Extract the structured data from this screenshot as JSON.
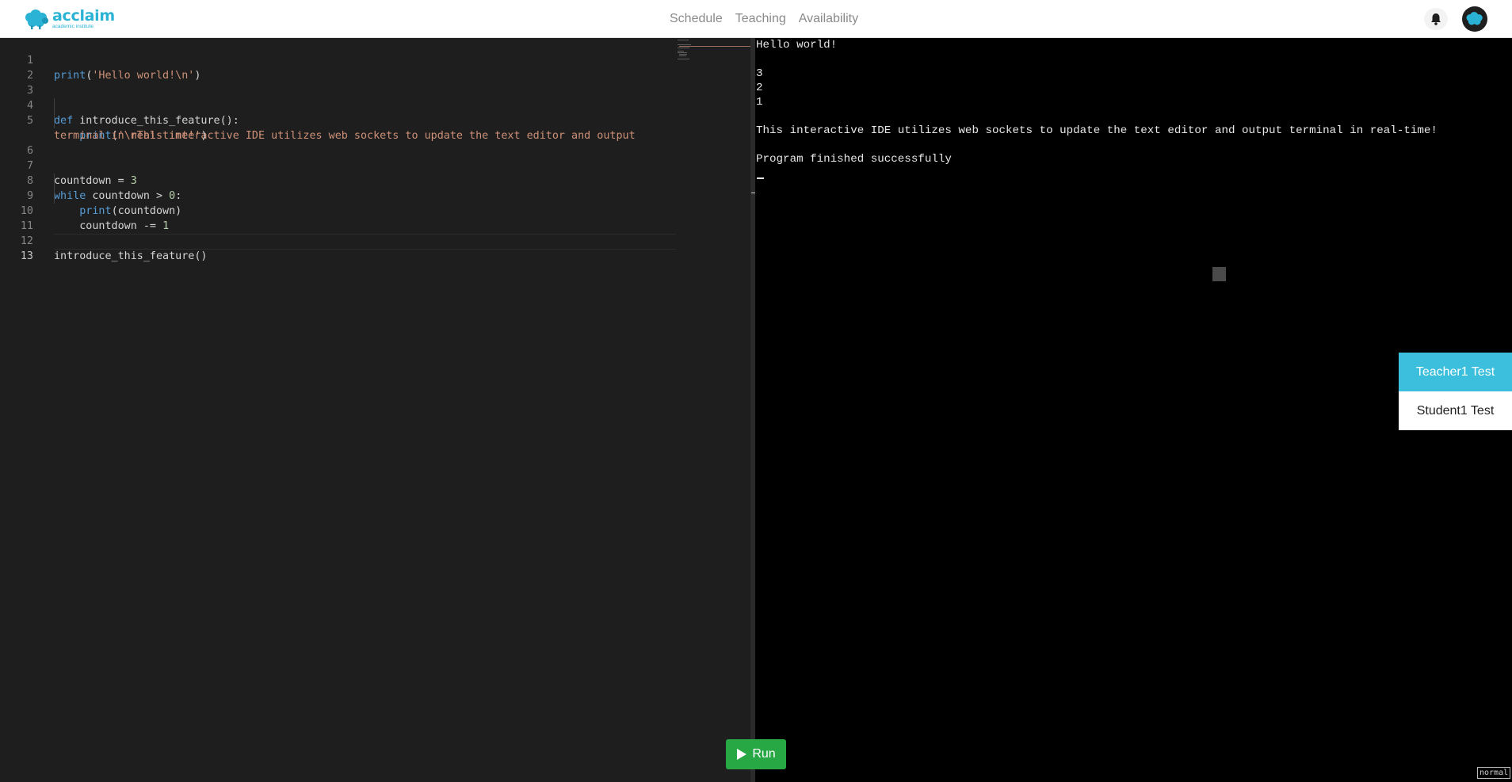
{
  "app": {
    "brand": "acclaim",
    "brand_sub": "academic institute",
    "accent": "#2bb3d6"
  },
  "nav": {
    "links": [
      "Schedule",
      "Teaching",
      "Availability"
    ],
    "bell_icon": "bell-icon",
    "avatar_icon": "user-avatar-icon"
  },
  "editor": {
    "line_numbers": [
      "1",
      "2",
      "3",
      "4",
      "5",
      "",
      "6",
      "7",
      "8",
      "9",
      "10",
      "11",
      "12",
      "13"
    ],
    "current_line": 13,
    "lines": [
      "print('Hello world!\\n')",
      "",
      "",
      "def introduce_this_feature():",
      "    print('\\nThis interactive IDE utilizes web sockets to update the text editor and output",
      "terminal in real-time!')",
      "",
      "countdown = 3",
      "while countdown > 0:",
      "    print(countdown)",
      "    countdown -= 1",
      "",
      "introduce_this_feature()",
      ""
    ]
  },
  "terminal": {
    "lines": [
      "Hello world!",
      "",
      "3",
      "2",
      "1",
      "",
      "This interactive IDE utilizes web sockets to update the text editor and output terminal in real-time!",
      "",
      "Program finished successfully"
    ],
    "mode": "normal"
  },
  "users": {
    "items": [
      "Teacher1 Test",
      "Student1 Test"
    ],
    "active": "Teacher1 Test"
  },
  "run_button": {
    "label": "Run",
    "color": "#28a745"
  }
}
